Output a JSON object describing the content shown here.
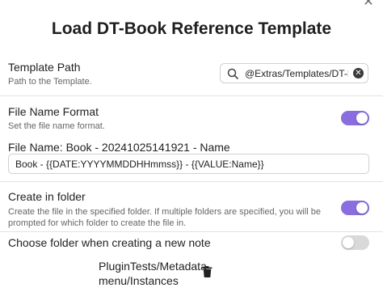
{
  "modal": {
    "title": "Load DT-Book Reference Template",
    "close_icon": "close-icon"
  },
  "template_path": {
    "name": "Template Path",
    "desc": "Path to the Template.",
    "value": "@Extras/Templates/DT-B",
    "search_icon": "search-icon",
    "clear_icon": "clear-icon"
  },
  "file_name_format": {
    "name": "File Name Format",
    "desc": "Set the file name format.",
    "enabled": true,
    "preview": "File Name: Book - 20241025141921 - Name",
    "value": "Book - {{DATE:YYYYMMDDHHmmss}} - {{VALUE:Name}}"
  },
  "create_in_folder": {
    "name": "Create in folder",
    "desc": "Create the file in the specified folder. If multiple folders are specified, you will be prompted for which folder to create the file in.",
    "enabled": true
  },
  "choose_folder": {
    "name": "Choose folder when creating a new note",
    "enabled": false
  },
  "folders": [
    {
      "path": "PluginTests/Metadatamenu/Instances"
    }
  ],
  "colors": {
    "accent": "#8a6ee0",
    "toggle_off": "#d9d9d9"
  }
}
